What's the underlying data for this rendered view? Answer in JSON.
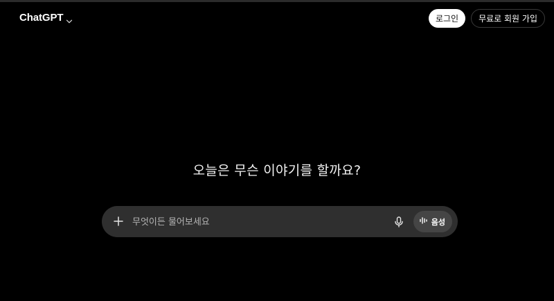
{
  "header": {
    "brand": "ChatGPT",
    "login_label": "로그인",
    "signup_label": "무료로 회원 가입"
  },
  "hero": {
    "title": "오늘은 무슨 이야기를 할까요?"
  },
  "composer": {
    "placeholder": "무엇이든 물어보세요",
    "voice_label": "음성"
  },
  "icons": {
    "brand_chevron": "chevron-down-icon",
    "attach": "plus-icon",
    "dictate": "microphone-icon",
    "voice": "waveform-icon"
  },
  "colors": {
    "background": "#000000",
    "composer_bg": "#2f2f2f",
    "voice_button_bg": "#454545",
    "login_button_bg": "#ffffff"
  }
}
